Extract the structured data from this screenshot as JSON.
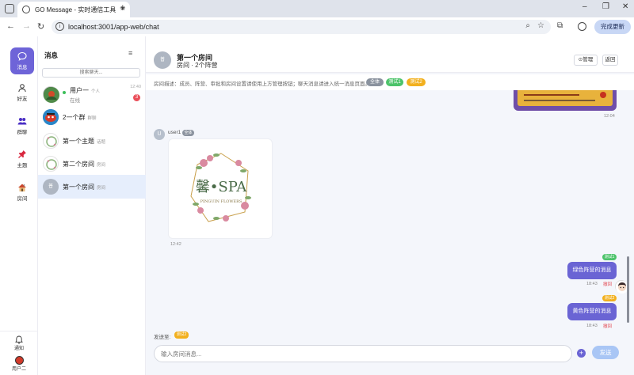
{
  "browser": {
    "tab_title": "GO Message - 实时通信工具",
    "url": "localhost:3001/app-web/chat",
    "update_button": "完成更新"
  },
  "rail": {
    "items": [
      {
        "label": "消息",
        "icon": "chat-bubble-icon"
      },
      {
        "label": "好友",
        "icon": "person-icon"
      },
      {
        "label": "群聊",
        "icon": "group-icon"
      },
      {
        "label": "主题",
        "icon": "pin-icon"
      },
      {
        "label": "房间",
        "icon": "house-icon"
      }
    ],
    "notify_label": "通知",
    "user_label": "用户二"
  },
  "conv_list": {
    "title": "消息",
    "search_placeholder": "搜索聊天...",
    "items": [
      {
        "name": "用户一",
        "tag": "个人",
        "sub": "在线",
        "time": "12:40",
        "badge": "3"
      },
      {
        "name": "2一个群",
        "tag": "群聊"
      },
      {
        "name": "第一个主题",
        "tag": "话题"
      },
      {
        "name": "第二个房间",
        "tag": "房间"
      },
      {
        "name": "第一个房间",
        "tag": "房间",
        "avatar_text": "普"
      }
    ]
  },
  "chat": {
    "avatar_text": "普",
    "title": "第一个房间",
    "subtitle": "房间 · 2个阵营",
    "manage_button": "⊙管理",
    "back_button": "返回",
    "description": "房间描述：成员、阵营、审批和房间设置请使用上方管理按钮；聊天消息请进入统一消息页面。",
    "camps": [
      "全体",
      "测试1",
      "测试2"
    ],
    "messages": {
      "poster_time": "12:04",
      "user1_name": "user1",
      "user1_avatar": "U",
      "user1_tag": "全体",
      "image_text": "馨•SPA",
      "image_subtext": "PINGUIN FLOWERS",
      "image_time": "12:42",
      "green_tag": "测试1",
      "green_text": "绿色阵营的消息",
      "green_time": "18:43",
      "green_recall": "撤回",
      "yellow_tag": "测试2",
      "yellow_text": "黄色阵营的消息",
      "yellow_time": "18:43",
      "yellow_recall": "撤回"
    },
    "send_to_label": "发送至:",
    "send_to_tag": "测试2",
    "input_placeholder": "输入房间消息...",
    "send_button": "发送"
  },
  "colors": {
    "accent": "#6a64d4",
    "camp_all": "#8a929e",
    "camp_green": "#4cc36a",
    "camp_yellow": "#f2b01e"
  }
}
